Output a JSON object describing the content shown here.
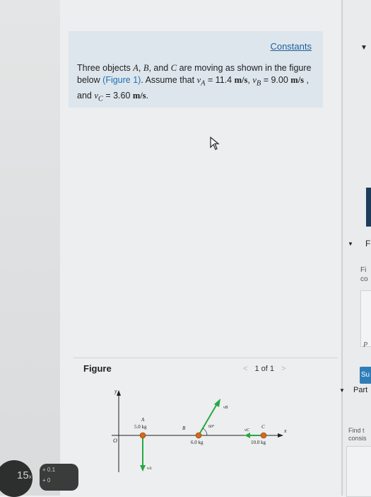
{
  "problem": {
    "constants_link": "Constants",
    "text_1": "Three objects",
    "obj_a": "A",
    "obj_b": "B",
    "and_word": ", and",
    "obj_c": "C",
    "text_2": "are moving as shown in the figure below",
    "figure_link": "(Figure 1)",
    "text_3": ". Assume that",
    "va_sym": "v",
    "va_sub": "A",
    "va_val": " = 11.4 ",
    "va_unit": "m/s",
    "vb_sym": "v",
    "vb_sub": "B",
    "vb_val": " = 9.00 ",
    "vb_unit": "m/s",
    "and_2": " , and ",
    "vc_sym": "v",
    "vc_sub": "C",
    "vc_val": " = 3.60 ",
    "vc_unit": "m/s"
  },
  "figure": {
    "title": "Figure",
    "pager": "1 of 1",
    "prev": "<",
    "next": ">",
    "y_label": "y",
    "x_label": "x",
    "origin_label": "O",
    "a_label": "A",
    "a_mass": "5.0 kg",
    "a_vel": "vA",
    "b_label": "B",
    "b_mass": "6.0 kg",
    "b_vel": "vB",
    "b_angle": "60°",
    "c_label": "C",
    "c_mass": "10.0 kg",
    "c_vel": "vC"
  },
  "right_panel": {
    "arrow": "▼",
    "f_label": "F",
    "fi_1": "Fi",
    "fi_2": "co",
    "p_label": "P",
    "submit": "Su",
    "part": "Part",
    "find_1": "Find t",
    "find_2": "consis"
  },
  "overlay": {
    "badge_num": "15",
    "badge_unit": "x",
    "pill_a": "0.1",
    "pill_b": "0"
  },
  "colors": {
    "accent_green": "#27a844",
    "mass_orange": "#d2691e",
    "link_blue": "#1e5f9b"
  }
}
